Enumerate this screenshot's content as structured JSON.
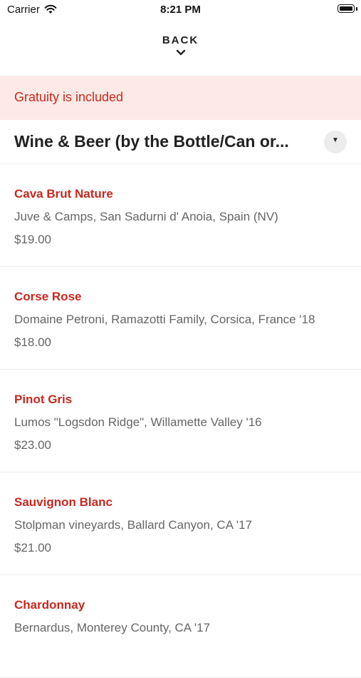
{
  "status_bar": {
    "carrier": "Carrier",
    "time": "8:21 PM"
  },
  "nav": {
    "back_label": "BACK"
  },
  "notice": {
    "text": "Gratuity is included",
    "background": "#fdeae6",
    "color": "#c8281e"
  },
  "category": {
    "title": "Wine & Beer (by the Bottle/Can or...",
    "dropdown_icon": "caret-down-icon"
  },
  "menu_items": [
    {
      "name": "Cava Brut Nature",
      "description": "Juve & Camps, San Sadurni d' Anoia, Spain (NV)",
      "price": "$19.00"
    },
    {
      "name": "Corse Rose",
      "description": "Domaine Petroni, Ramazotti Family, Corsica, France '18",
      "price": "$18.00"
    },
    {
      "name": "Pinot Gris",
      "description": "Lumos \"Logsdon Ridge\", Willamette Valley '16",
      "price": "$23.00"
    },
    {
      "name": "Sauvignon Blanc",
      "description": "Stolpman vineyards, Ballard Canyon, CA '17",
      "price": "$21.00"
    },
    {
      "name": "Chardonnay",
      "description": "Bernardus, Monterey County, CA '17",
      "price": ""
    }
  ],
  "colors": {
    "accent": "#c8281e",
    "divider": "#ececec"
  }
}
